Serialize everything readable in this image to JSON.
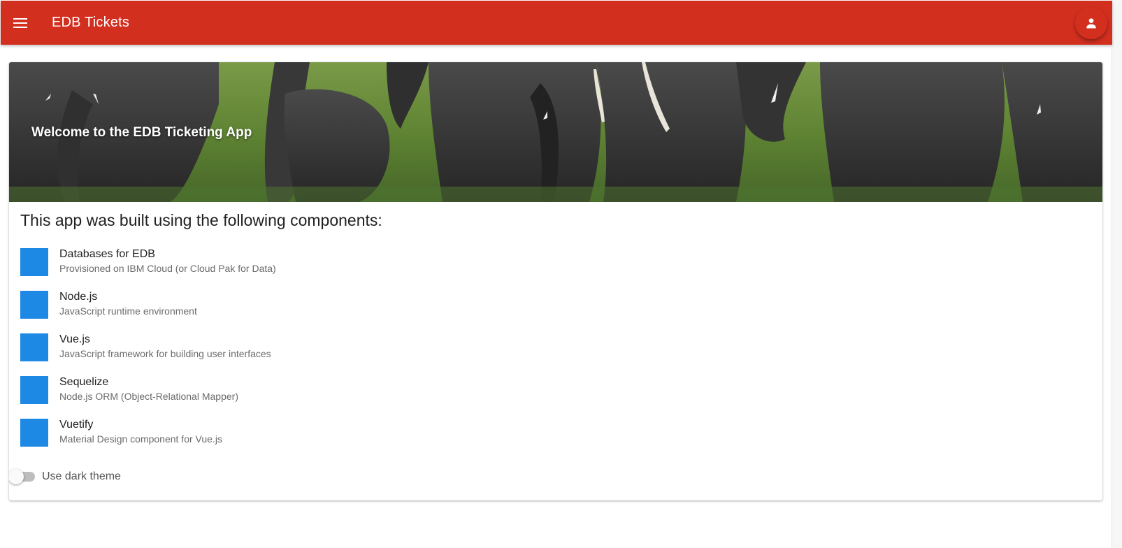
{
  "app_bar": {
    "title": "EDB Tickets",
    "menu_icon": "menu-icon",
    "account_icon": "account-icon",
    "color": "#d32f1f"
  },
  "hero": {
    "title": "Welcome to the EDB Ticketing App",
    "image": "elephant-herd-photo"
  },
  "main": {
    "heading": "This app was built using the following components:",
    "swatch_color": "#1e88e5",
    "components": [
      {
        "title": "Databases for EDB",
        "subtitle": "Provisioned on IBM Cloud (or Cloud Pak for Data)"
      },
      {
        "title": "Node.js",
        "subtitle": "JavaScript runtime environment"
      },
      {
        "title": "Vue.js",
        "subtitle": "JavaScript framework for building user interfaces"
      },
      {
        "title": "Sequelize",
        "subtitle": "Node.js ORM (Object-Relational Mapper)"
      },
      {
        "title": "Vuetify",
        "subtitle": "Material Design component for Vue.js"
      }
    ]
  },
  "settings": {
    "dark_theme_label": "Use dark theme",
    "dark_theme_enabled": false
  }
}
